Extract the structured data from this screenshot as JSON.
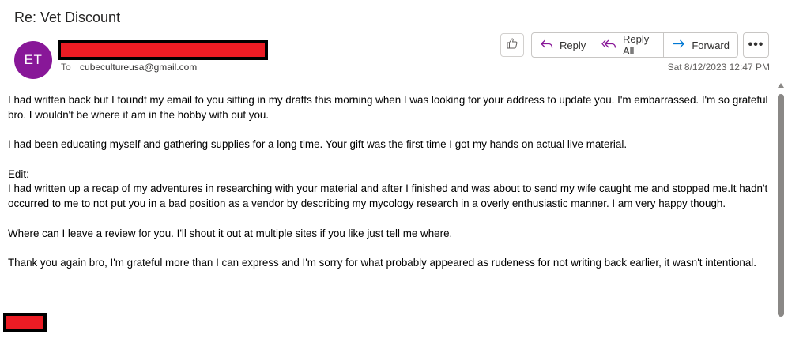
{
  "email": {
    "subject": "Re: Vet Discount",
    "sender_initials": "ET",
    "avatar_color": "#881798",
    "to_label": "To",
    "to_address": "cubecultureusa@gmail.com",
    "date": "Sat 8/12/2023 12:47 PM",
    "body": {
      "p1": "I had written back but I foundt my email to you sitting in my drafts this morning when I was looking for your address to update you. I'm embarrassed. I'm so grateful bro. I wouldn't  be where it am in the hobby with out you.",
      "p2": "I had been educating myself and gathering supplies for a long time. Your gift was the first time I got my hands on actual live material.",
      "p3_heading": "Edit:",
      "p3": "I had written up a recap of my adventures in researching with your material and after I finished and was about to send my wife caught me and stopped me.It hadn't occurred to me to not put you in a bad position as a vendor by describing my mycology research in a overly enthusiastic manner. I am very happy though.",
      "p4": "Where can I leave a review for you.  I'll shout it out at multiple sites if you like just tell me where.",
      "p5": "Thank you again bro, I'm grateful more than I can express and I'm sorry for what probably appeared as rudeness for not writing back earlier, it wasn't intentional."
    }
  },
  "toolbar": {
    "like_icon": "thumbs-up-icon",
    "reply_label": "Reply",
    "reply_all_label": "Reply All",
    "forward_label": "Forward",
    "more_label": "•••"
  },
  "colors": {
    "redaction": "#ec1c24",
    "reply_icon": "#881798",
    "forward_icon": "#0078d4"
  }
}
